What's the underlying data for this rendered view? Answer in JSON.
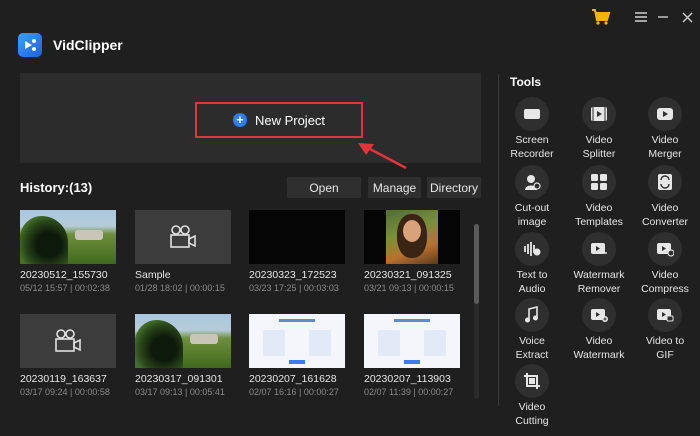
{
  "app": {
    "title": "VidClipper"
  },
  "new_project": {
    "label": "New Project"
  },
  "history": {
    "title": "History:(13)",
    "buttons": {
      "open": "Open",
      "manage": "Manage",
      "directory": "Directory"
    },
    "items": [
      {
        "name": "20230512_155730",
        "meta": "05/12 15:57 | 00:02:38",
        "thumb": "cave"
      },
      {
        "name": "Sample",
        "meta": "01/28 18:02 | 00:00:15",
        "thumb": "camera"
      },
      {
        "name": "20230323_172523",
        "meta": "03/23 17:25 | 00:03:03",
        "thumb": "black"
      },
      {
        "name": "20230321_091325",
        "meta": "03/21 09:13 | 00:00:15",
        "thumb": "portrait"
      },
      {
        "name": "20230119_163637",
        "meta": "03/17 09:24 | 00:00:58",
        "thumb": "camera"
      },
      {
        "name": "20230317_091301",
        "meta": "03/17 09:13 | 00:05:41",
        "thumb": "cave"
      },
      {
        "name": "20230207_161628",
        "meta": "02/07 16:16 | 00:00:27",
        "thumb": "doc"
      },
      {
        "name": "20230207_113903",
        "meta": "02/07 11:39 | 00:00:27",
        "thumb": "doc"
      }
    ]
  },
  "tools": {
    "title": "Tools",
    "items": [
      {
        "label": "Screen\nRecorder",
        "icon": "screen-recorder-icon"
      },
      {
        "label": "Video\nSplitter",
        "icon": "video-splitter-icon"
      },
      {
        "label": "Video\nMerger",
        "icon": "video-merger-icon"
      },
      {
        "label": "Cut-out\nimage",
        "icon": "cutout-image-icon"
      },
      {
        "label": "Video\nTemplates",
        "icon": "video-templates-icon"
      },
      {
        "label": "Video\nConverter",
        "icon": "video-converter-icon"
      },
      {
        "label": "Text to\nAudio",
        "icon": "text-to-audio-icon"
      },
      {
        "label": "Watermark\nRemover",
        "icon": "watermark-remover-icon"
      },
      {
        "label": "Video\nCompress",
        "icon": "video-compress-icon"
      },
      {
        "label": "Voice\nExtract",
        "icon": "voice-extract-icon"
      },
      {
        "label": "Video\nWatermark",
        "icon": "video-watermark-icon"
      },
      {
        "label": "Video to\nGIF",
        "icon": "video-to-gif-icon"
      },
      {
        "label": "Video\nCutting",
        "icon": "video-cutting-icon"
      }
    ]
  },
  "colors": {
    "accent": "#2f7cf6",
    "highlight_border": "#e0353a",
    "cart": "#f5b400"
  }
}
